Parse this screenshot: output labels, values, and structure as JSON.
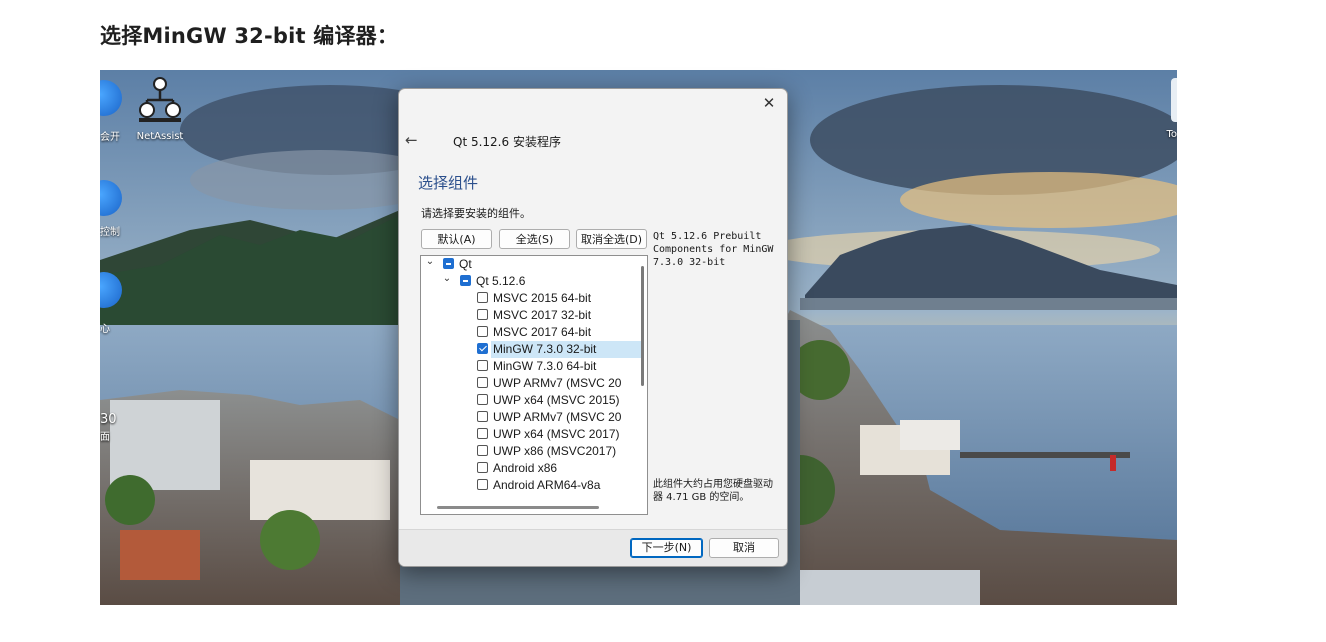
{
  "article": {
    "heading": "选择MinGW 32-bit 编译器："
  },
  "desktop": {
    "icons": [
      {
        "label": "NetAssist",
        "icon": "netassist-network-icon"
      }
    ],
    "partial_labels": [
      "会开",
      "控制",
      "心",
      "30",
      "面"
    ],
    "right_partial_label": "To"
  },
  "dialog": {
    "title": "Qt 5.12.6 安装程序",
    "close_glyph": "✕",
    "back_glyph": "←",
    "page_heading": "选择组件",
    "instruction": "请选择要安装的组件。",
    "buttons": {
      "default": "默认(A)",
      "select_all": "全选(S)",
      "deselect_all": "取消全选(D)",
      "next": "下一步(N)",
      "cancel": "取消"
    },
    "tree": [
      {
        "label": "Qt",
        "level": 0,
        "expandable": true,
        "state": "partial"
      },
      {
        "label": "Qt 5.12.6",
        "level": 1,
        "expandable": true,
        "state": "partial"
      },
      {
        "label": "MSVC 2015 64-bit",
        "level": 2,
        "state": "unchecked"
      },
      {
        "label": "MSVC 2017 32-bit",
        "level": 2,
        "state": "unchecked"
      },
      {
        "label": "MSVC 2017 64-bit",
        "level": 2,
        "state": "unchecked"
      },
      {
        "label": "MinGW 7.3.0 32-bit",
        "level": 2,
        "state": "checked",
        "highlighted": true
      },
      {
        "label": "MinGW 7.3.0 64-bit",
        "level": 2,
        "state": "unchecked"
      },
      {
        "label": "UWP ARMv7 (MSVC 20",
        "level": 2,
        "state": "unchecked"
      },
      {
        "label": "UWP x64 (MSVC 2015)",
        "level": 2,
        "state": "unchecked"
      },
      {
        "label": "UWP ARMv7 (MSVC 20",
        "level": 2,
        "state": "unchecked"
      },
      {
        "label": "UWP x64 (MSVC 2017)",
        "level": 2,
        "state": "unchecked"
      },
      {
        "label": "UWP x86 (MSVC2017)",
        "level": 2,
        "state": "unchecked"
      },
      {
        "label": "Android x86",
        "level": 2,
        "state": "unchecked"
      },
      {
        "label": "Android ARM64-v8a",
        "level": 2,
        "state": "unchecked"
      }
    ],
    "description": "Qt 5.12.6 Prebuilt\nComponents for MinGW\n7.3.0 32-bit",
    "size_note": "此组件大约占用您硬盘驱动器 4.71 GB 的空间。"
  },
  "colors": {
    "accent": "#1f6fd1",
    "highlight_row": "#cde6f7",
    "primary_border": "#0067c0"
  }
}
